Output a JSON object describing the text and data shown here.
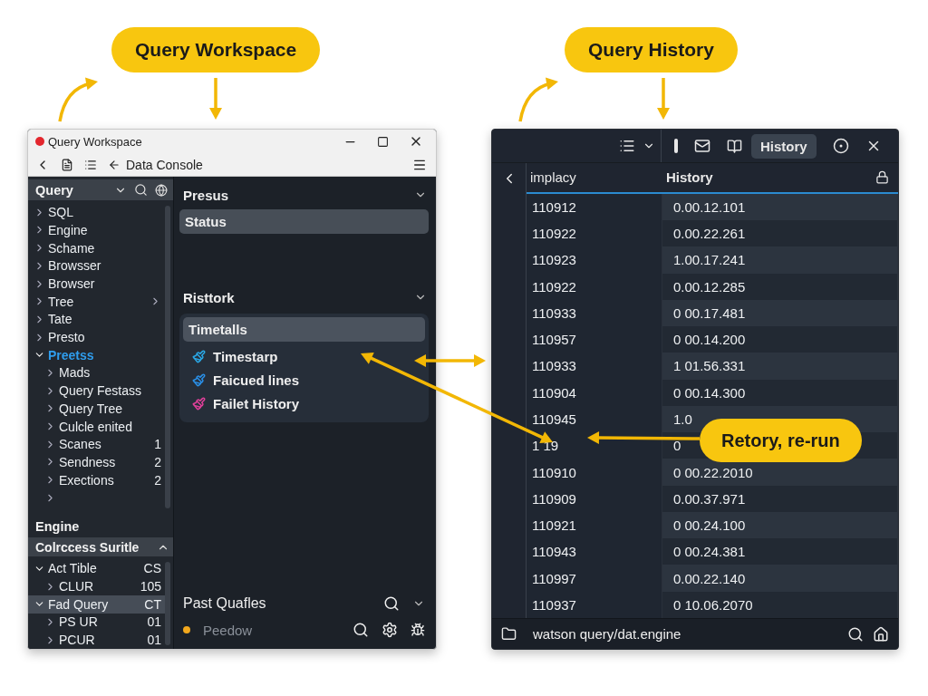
{
  "workspace": {
    "callout": "Query Workspace",
    "window_title": "Query Workspace",
    "toolbar_label": "Data Console",
    "sidebar": {
      "header": "Query",
      "tree": [
        {
          "label": "SQL",
          "expanded": false,
          "selected": false,
          "submenu": false
        },
        {
          "label": "Engine",
          "expanded": false,
          "selected": false,
          "submenu": false
        },
        {
          "label": "Schame",
          "expanded": false,
          "selected": false,
          "submenu": false
        },
        {
          "label": "Browsser",
          "expanded": false,
          "selected": false,
          "submenu": false
        },
        {
          "label": "Browser",
          "expanded": false,
          "selected": false,
          "submenu": false
        },
        {
          "label": "Tree",
          "expanded": false,
          "selected": false,
          "submenu": true
        },
        {
          "label": "Tate",
          "expanded": false,
          "selected": false,
          "submenu": false
        },
        {
          "label": "Presto",
          "expanded": false,
          "selected": false,
          "submenu": false
        },
        {
          "label": "Preetss",
          "expanded": true,
          "selected": true,
          "submenu": false,
          "children": [
            {
              "label": "Mads",
              "expanded": false,
              "selected": false
            },
            {
              "label": "Query Festass",
              "expanded": false,
              "selected": false
            },
            {
              "label": "Query Tree",
              "expanded": false,
              "selected": false
            },
            {
              "label": "Culcle enited",
              "expanded": false,
              "selected": false
            },
            {
              "label": "Scanes",
              "count": "1",
              "expanded": false,
              "selected": false
            },
            {
              "label": "Sendness",
              "count": "2",
              "expanded": false,
              "selected": false
            },
            {
              "label": "Exections",
              "count": "2",
              "expanded": false,
              "selected": false
            },
            {
              "expanded": false,
              "selected": false
            }
          ]
        }
      ],
      "section_label": "Engine",
      "subheader": "Colrccess Suritle",
      "subtree": [
        {
          "label": "Act Tible",
          "count": "CS",
          "expanded": true,
          "selected": false,
          "children": [
            {
              "label": "CLUR",
              "count": "105",
              "expanded": false,
              "selected": false
            }
          ]
        },
        {
          "label": "Fad Query",
          "count": "CT",
          "expanded": true,
          "selected": true,
          "children": [
            {
              "label": "PS UR",
              "count": "01",
              "expanded": false,
              "selected": false
            },
            {
              "label": "PCUR",
              "count": "01",
              "expanded": false,
              "selected": false
            }
          ]
        }
      ]
    },
    "main": {
      "status_section": {
        "title": "Presus",
        "bar": "Status"
      },
      "recent_section": {
        "title": "Risttork",
        "panel_title": "Timetalls",
        "items": [
          {
            "label": "Timestarp",
            "color": "#2aa8e6"
          },
          {
            "label": "Faicued lines",
            "color": "#2a8fe6"
          },
          {
            "label": "Failet History",
            "color": "#e0409a"
          }
        ]
      },
      "past_section": {
        "title": "Past Quafles",
        "placeholder": "Peedow"
      }
    }
  },
  "history": {
    "callout": "Query History",
    "history_button": {
      "label": "History",
      "selected": true
    },
    "columns": [
      "implacy",
      "History"
    ],
    "rows": [
      {
        "id": "110912",
        "time": "0.00.12.101"
      },
      {
        "id": "110922",
        "time": "0.00.22.261"
      },
      {
        "id": "110923",
        "time": "1.00.17.241"
      },
      {
        "id": "110922",
        "time": "0.00.12.285"
      },
      {
        "id": "110933",
        "time": "0 00.17.481"
      },
      {
        "id": "110957",
        "time": "0 00.14.200"
      },
      {
        "id": "110933",
        "time": "1 01.56.331"
      },
      {
        "id": "110904",
        "time": "0 00.14.300"
      },
      {
        "id": "110945",
        "time": "1.0"
      },
      {
        "id": "1 19",
        "time": "0"
      },
      {
        "id": "110910",
        "time": "0 00.22.2010"
      },
      {
        "id": "110909",
        "time": "0.00.37.971"
      },
      {
        "id": "110921",
        "time": "0 00.24.100"
      },
      {
        "id": "110943",
        "time": "0 00.24.381"
      },
      {
        "id": "110997",
        "time": "0.00.22.140"
      },
      {
        "id": "110937",
        "time": "0 10.06.2070"
      }
    ],
    "path": "watson query/dat.engine"
  },
  "annotation": {
    "text": "Retory, re-run"
  }
}
